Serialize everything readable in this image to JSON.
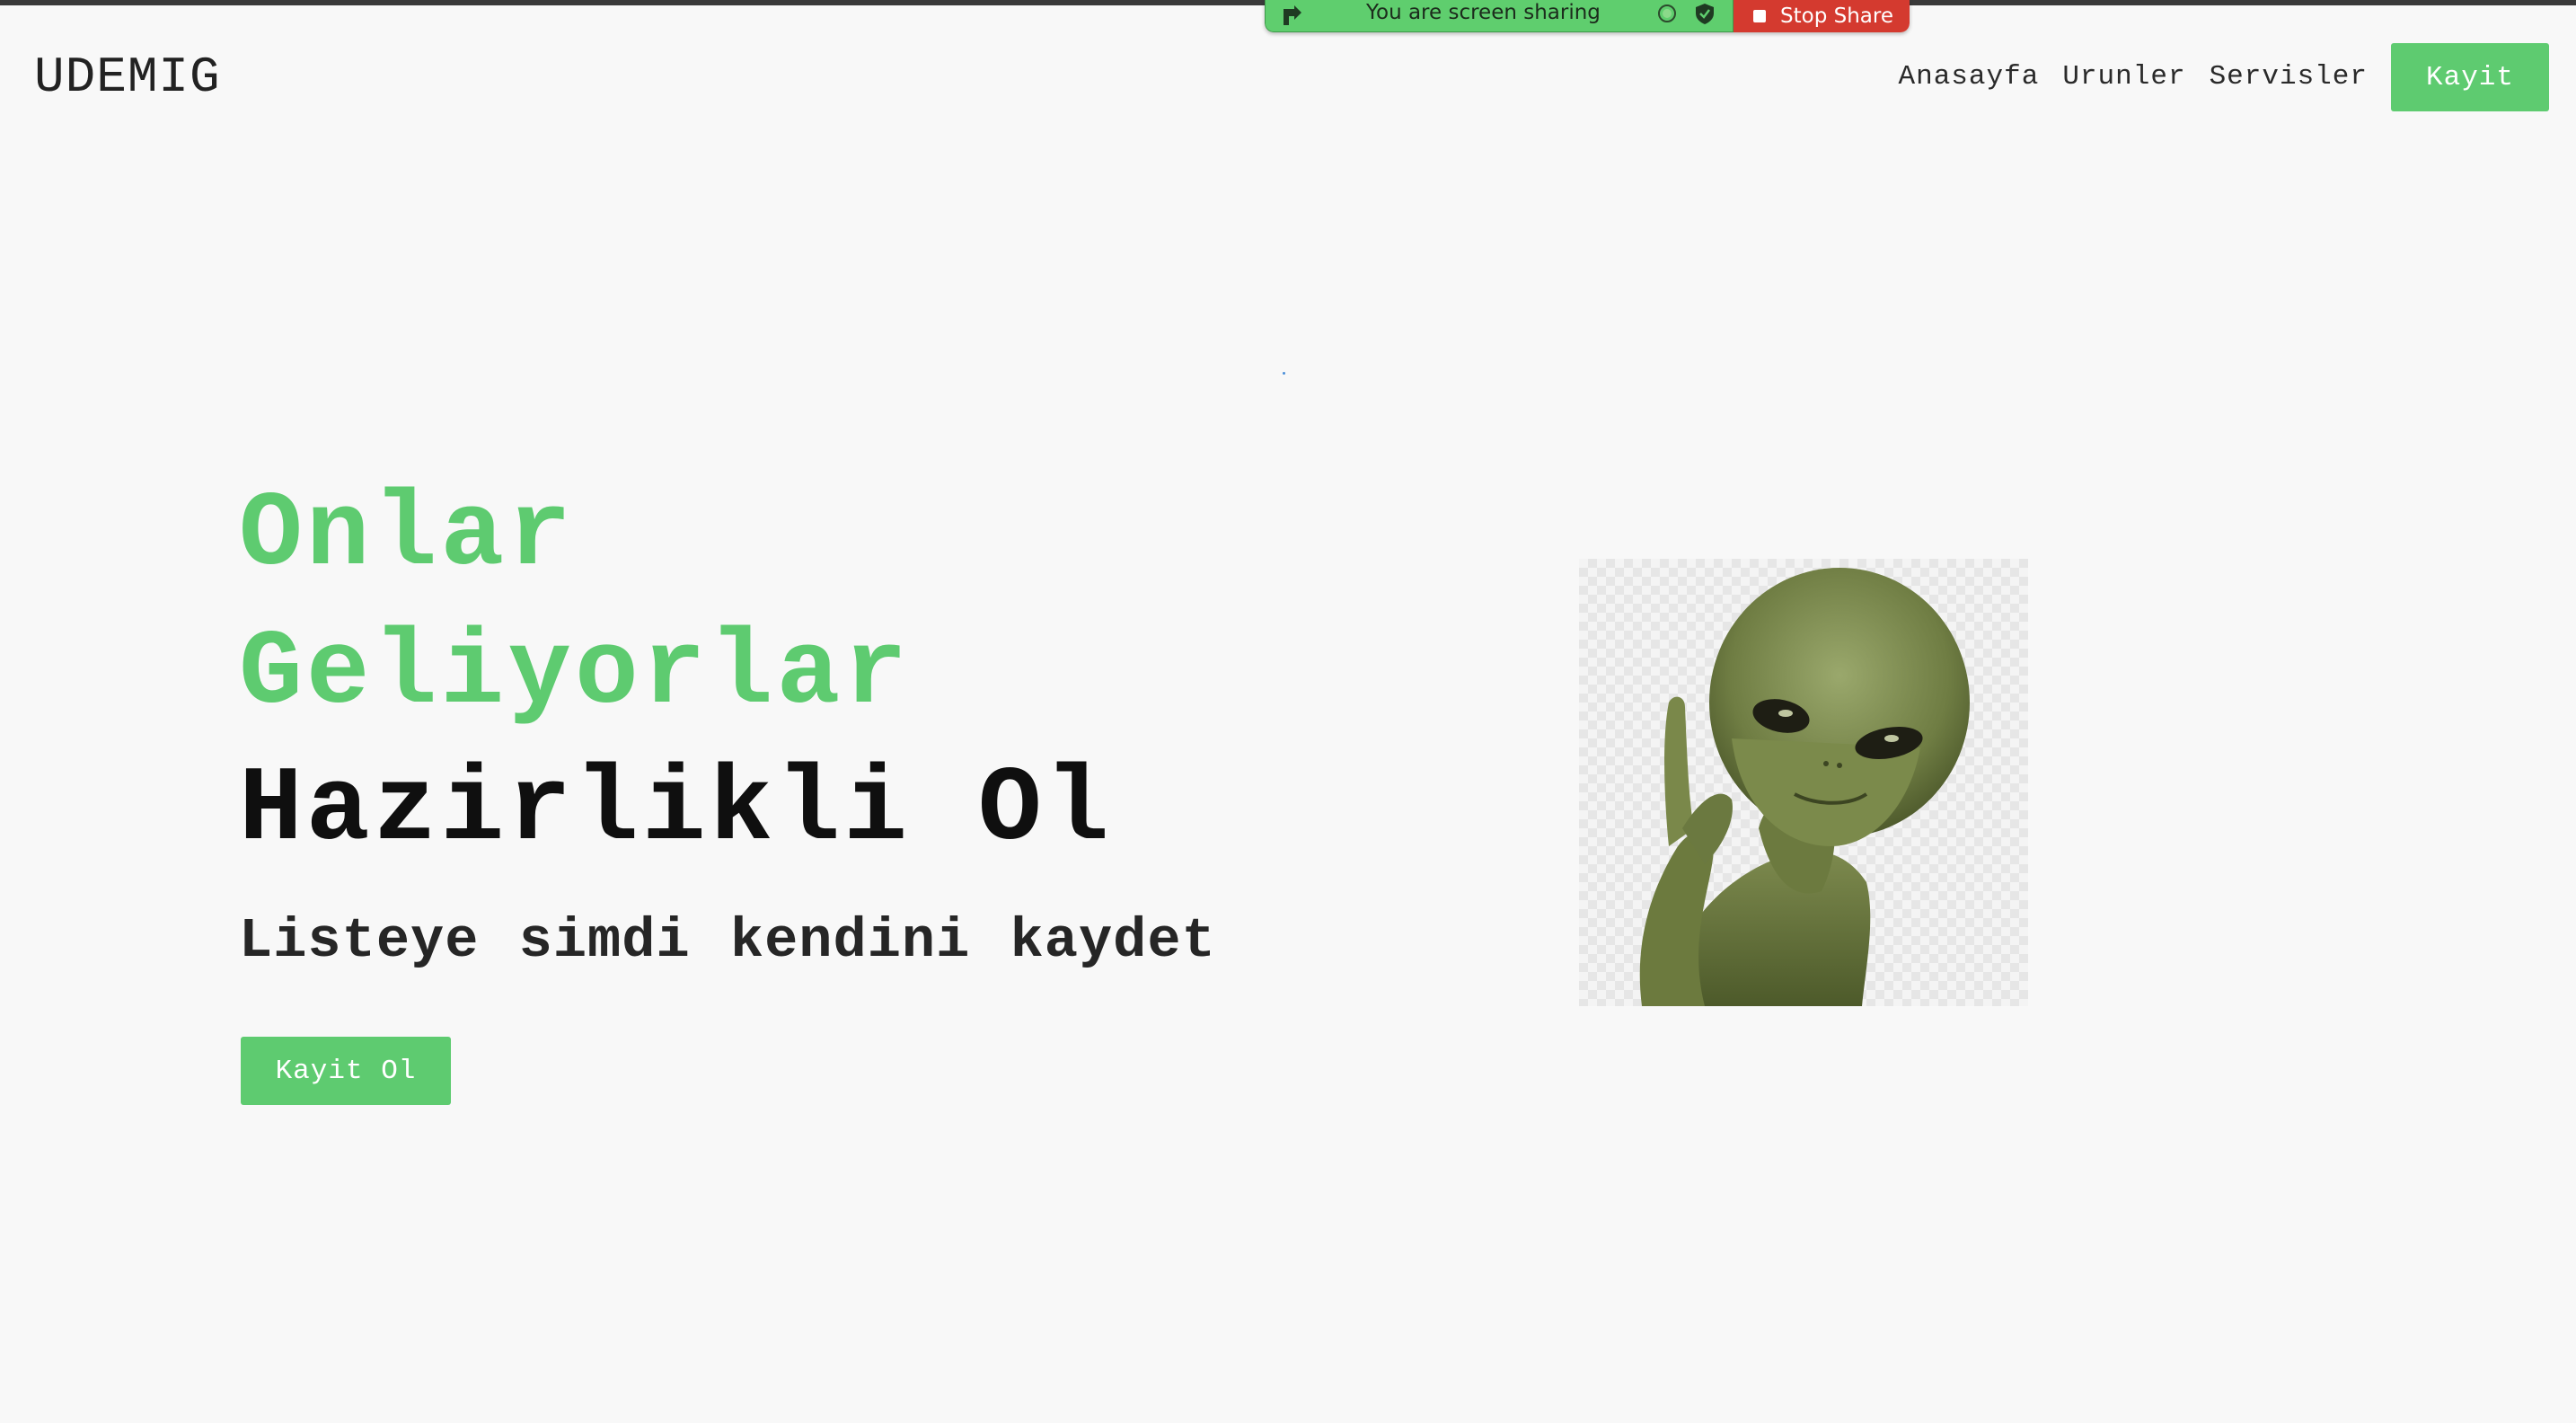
{
  "share_bar": {
    "status_text": "You are screen sharing",
    "stop_label": "Stop Share",
    "icons": [
      "share-arrow-icon",
      "status-dot-icon",
      "shield-icon",
      "stop-square-icon"
    ]
  },
  "header": {
    "logo": "UDEMIG",
    "nav": {
      "home": "Anasayfa",
      "products": "Urunler",
      "services": "Servisler",
      "register": "Kayit"
    }
  },
  "hero": {
    "line1": "Onlar",
    "line2": "Geliyorlar",
    "line3": "Hazirlikli Ol",
    "subtitle": "Listeye simdi kendini kaydet",
    "cta": "Kayit Ol",
    "image_icon": "alien-illustration"
  },
  "colors": {
    "accent": "#5ecb70",
    "background": "#f8f8f8",
    "text_dark": "#0f0f0f",
    "share_green": "#5fce6e",
    "share_red": "#d43a2f"
  }
}
